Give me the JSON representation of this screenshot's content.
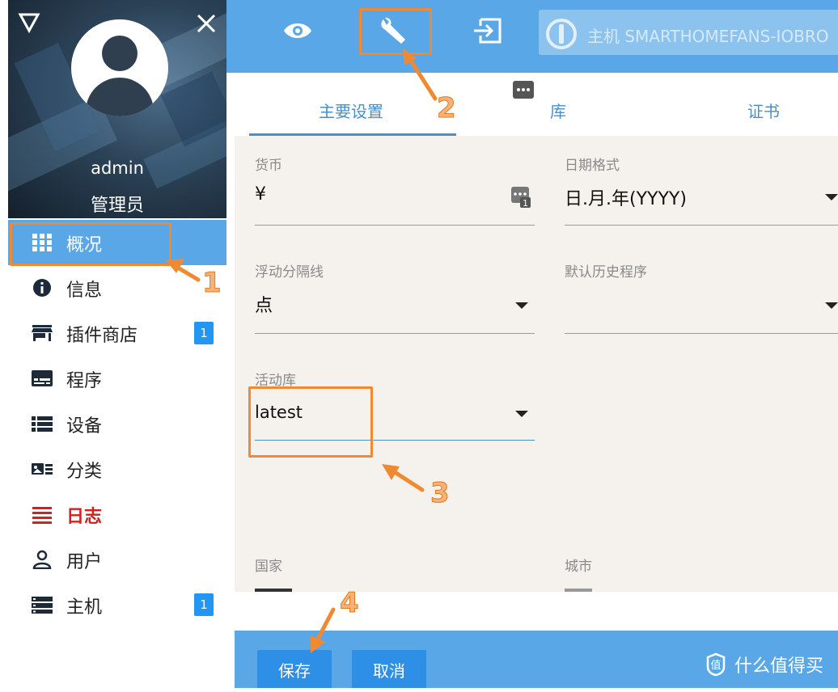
{
  "sidebar": {
    "user": {
      "name": "admin",
      "role": "管理员"
    },
    "items": [
      {
        "label": "概况",
        "icon": "apps-grid-icon",
        "active": true
      },
      {
        "label": "信息",
        "icon": "info-icon"
      },
      {
        "label": "插件商店",
        "icon": "store-icon",
        "badge": "1"
      },
      {
        "label": "程序",
        "icon": "instances-icon"
      },
      {
        "label": "设备",
        "icon": "list-icon"
      },
      {
        "label": "分类",
        "icon": "categories-icon"
      },
      {
        "label": "日志",
        "icon": "log-icon",
        "color": "#d21f1f"
      },
      {
        "label": "用户",
        "icon": "user-icon"
      },
      {
        "label": "主机",
        "icon": "hosts-icon",
        "badge": "1"
      }
    ]
  },
  "topbar": {
    "buttons": [
      "eye-icon",
      "wrench-icon",
      "logout-icon"
    ],
    "host_text": "主机 SMARTHOMEFANS-IOBRO"
  },
  "settings": {
    "tabs": [
      "主要设置",
      "库",
      "证书"
    ],
    "active_tab": "主要设置",
    "fields": {
      "currency": {
        "label": "货币",
        "value": "¥"
      },
      "date_format": {
        "label": "日期格式",
        "value": "日.月.年(YYYY)"
      },
      "float_separator": {
        "label": "浮动分隔线",
        "value": "点"
      },
      "default_history": {
        "label": "默认历史程序",
        "value": ""
      },
      "active_repo": {
        "label": "活动库",
        "value": "latest"
      },
      "country": {
        "label": "国家"
      },
      "city": {
        "label": "城市"
      }
    }
  },
  "footer": {
    "save_label": "保存",
    "cancel_label": "取消",
    "watermark": "什么值得买"
  },
  "annotations": [
    "1",
    "2",
    "3",
    "4"
  ],
  "colors": {
    "accent": "#5aa7e8",
    "button": "#2e8fe6",
    "tab_text": "#4a90c8",
    "annotation": "#f08a32",
    "log_red": "#d21f1f"
  }
}
